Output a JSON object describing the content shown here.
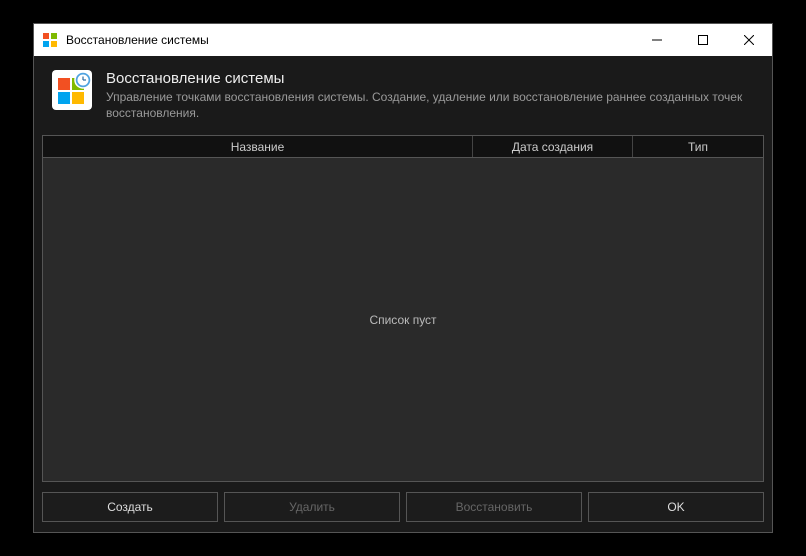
{
  "titlebar": {
    "title": "Восстановление системы"
  },
  "header": {
    "title": "Восстановление системы",
    "description": "Управление точками восстановления системы. Создание, удаление или восстановление раннее созданных точек восстановления."
  },
  "table": {
    "columns": {
      "name": "Название",
      "date": "Дата создания",
      "type": "Тип"
    },
    "empty_message": "Список пуст",
    "rows": []
  },
  "buttons": {
    "create": "Создать",
    "delete": "Удалить",
    "restore": "Восстановить",
    "ok": "OK"
  }
}
